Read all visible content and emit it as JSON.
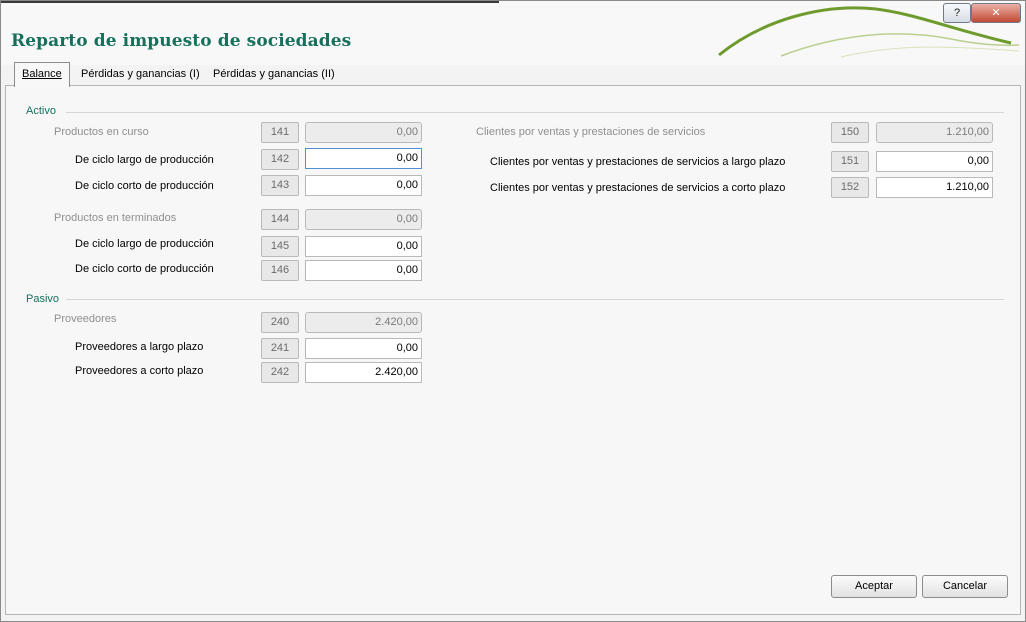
{
  "window": {
    "title": "Reparto de impuesto de sociedades",
    "help_label": "?",
    "close_label": "✕"
  },
  "tabs": [
    {
      "label": "Balance",
      "active": true
    },
    {
      "label": "Pérdidas y ganancias (I)",
      "active": false
    },
    {
      "label": "Pérdidas y ganancias (II)",
      "active": false
    }
  ],
  "activo": {
    "title": "Activo",
    "productos_curso": {
      "label": "Productos en curso",
      "code": "141",
      "value": "0,00"
    },
    "curso_largo": {
      "label": "De ciclo largo de producción",
      "code": "142",
      "value": "0,00"
    },
    "curso_corto": {
      "label": "De ciclo corto de producción",
      "code": "143",
      "value": "0,00"
    },
    "productos_terminados": {
      "label": "Productos en terminados",
      "code": "144",
      "value": "0,00"
    },
    "term_largo": {
      "label": "De ciclo largo de producción",
      "code": "145",
      "value": "0,00"
    },
    "term_corto": {
      "label": "De ciclo corto de producción",
      "code": "146",
      "value": "0,00"
    },
    "clientes": {
      "label": "Clientes por ventas y prestaciones de servicios",
      "code": "150",
      "value": "1.210,00"
    },
    "clientes_largo": {
      "label": "Clientes por ventas y prestaciones de servicios a largo plazo",
      "code": "151",
      "value": "0,00"
    },
    "clientes_corto": {
      "label": "Clientes por ventas y prestaciones de servicios a corto plazo",
      "code": "152",
      "value": "1.210,00"
    }
  },
  "pasivo": {
    "title": "Pasivo",
    "proveedores": {
      "label": "Proveedores",
      "code": "240",
      "value": "2.420,00"
    },
    "prov_largo": {
      "label": "Proveedores a largo plazo",
      "code": "241",
      "value": "0,00"
    },
    "prov_corto": {
      "label": "Proveedores a corto plazo",
      "code": "242",
      "value": "2.420,00"
    }
  },
  "buttons": {
    "accept": "Aceptar",
    "cancel": "Cancelar"
  },
  "colors": {
    "accent": "#17705c",
    "swoosh": "#6f9b2e"
  }
}
